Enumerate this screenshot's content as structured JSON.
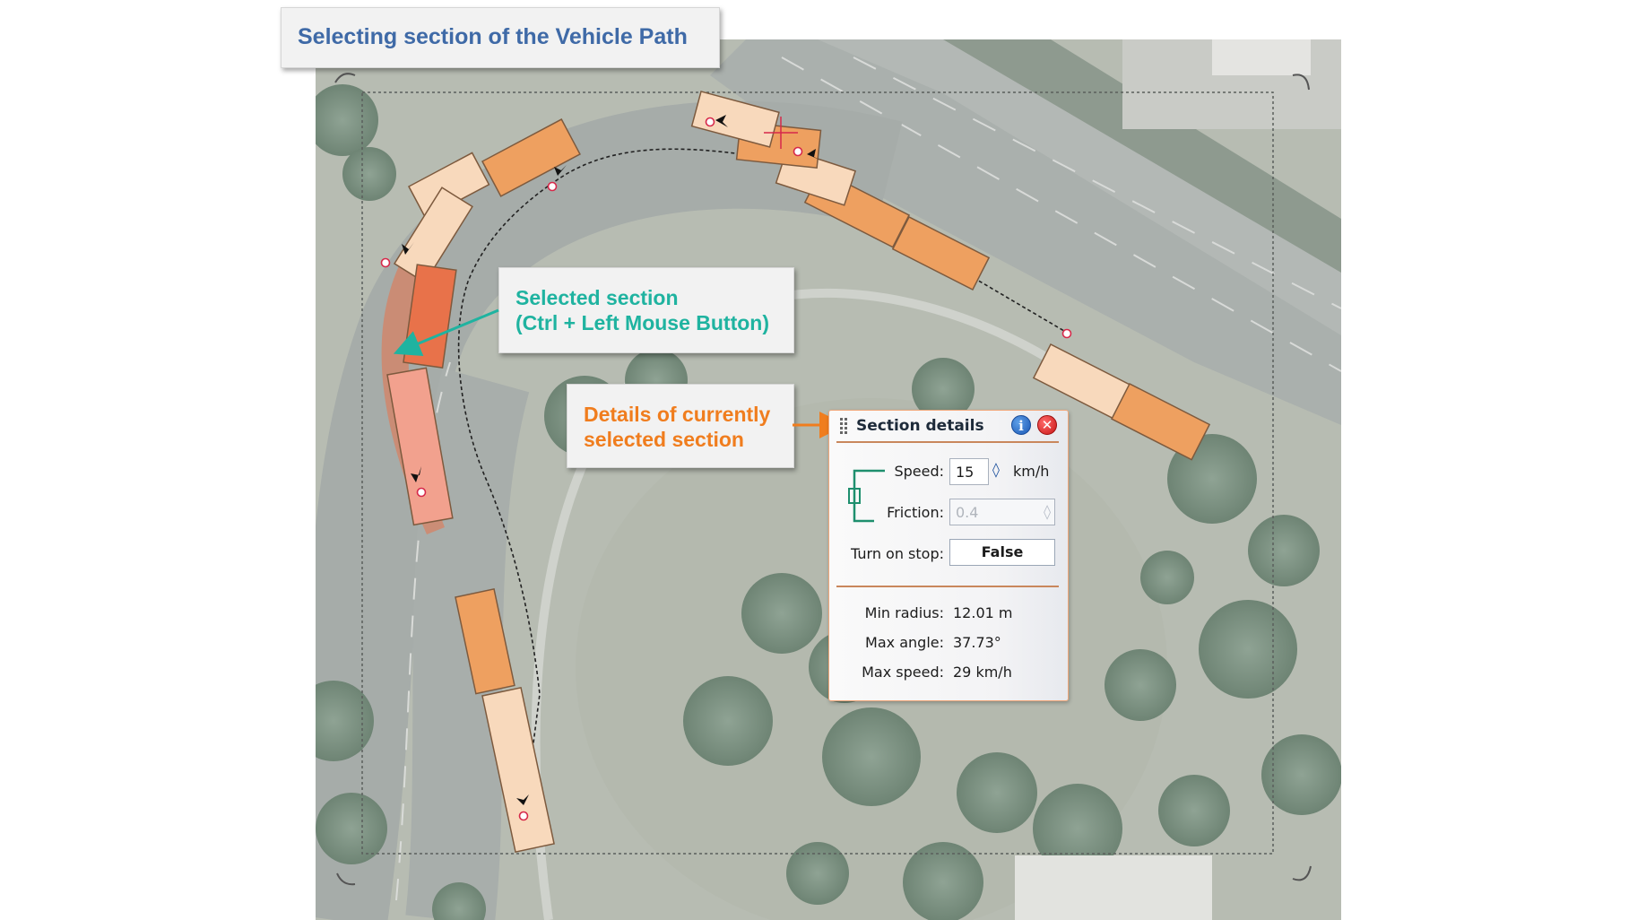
{
  "title_callout": "Selecting section of the Vehicle Path",
  "selected_callout": {
    "line1": "Selected section",
    "line2": "(Ctrl + Left Mouse Button)"
  },
  "details_callout": {
    "line1": "Details of currently",
    "line2": "selected section"
  },
  "section_panel": {
    "title": "Section details",
    "info_icon": "i",
    "close_icon": "✕",
    "speed_label": "Speed:",
    "speed_value": "15",
    "speed_unit": "km/h",
    "friction_label": "Friction:",
    "friction_value": "0.4",
    "turn_on_stop_label": "Turn on stop:",
    "turn_on_stop_value": "False",
    "min_radius_label": "Min radius:",
    "min_radius_value": "12.01 m",
    "max_angle_label": "Max angle:",
    "max_angle_value": "37.73°",
    "max_speed_label": "Max speed:",
    "max_speed_value": "29 km/h"
  },
  "colors": {
    "title_text": "#3f6aa7",
    "selected_callout_text": "#1fb3a0",
    "details_callout_text": "#f07d1e",
    "selected_section": "#e8724a",
    "vehicle_section": "#eea060"
  }
}
